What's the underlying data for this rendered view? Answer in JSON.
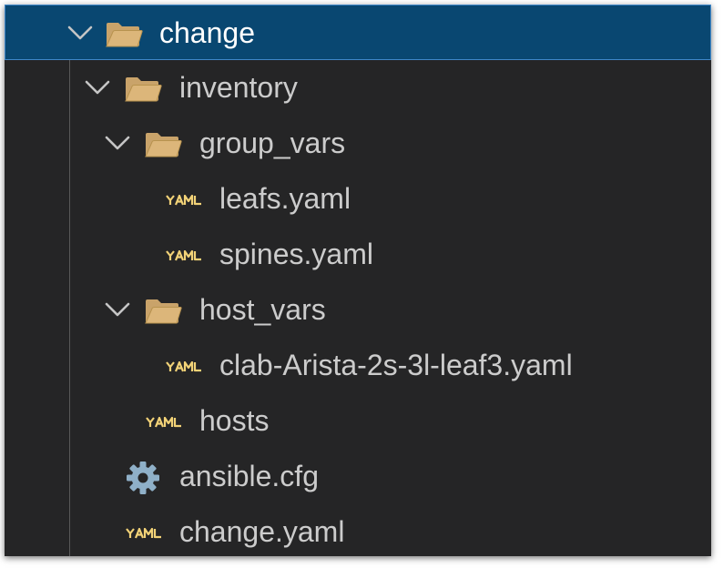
{
  "explorer": {
    "root": {
      "label": "change",
      "expanded": true,
      "selected": true
    },
    "inventory": {
      "label": "inventory",
      "expanded": true
    },
    "group_vars": {
      "label": "group_vars",
      "expanded": true
    },
    "leafs": {
      "label": "leafs.yaml"
    },
    "spines": {
      "label": "spines.yaml"
    },
    "host_vars": {
      "label": "host_vars",
      "expanded": true
    },
    "leaf3": {
      "label": "clab-Arista-2s-3l-leaf3.yaml"
    },
    "hosts": {
      "label": "hosts"
    },
    "ansible_cfg": {
      "label": "ansible.cfg"
    },
    "change_yaml": {
      "label": "change.yaml"
    }
  },
  "colors": {
    "background": "#252526",
    "selection": "#094771",
    "selection_border": "#3f87c9",
    "text": "#cccccc",
    "folder": "#dcb67a",
    "yaml_badge": "#f2d277",
    "gear": "#8fb0c8"
  },
  "icons": {
    "chevron": "chevron-down-icon",
    "folder": "folder-open-icon",
    "yaml": "yaml-file-icon",
    "config": "gear-icon"
  }
}
